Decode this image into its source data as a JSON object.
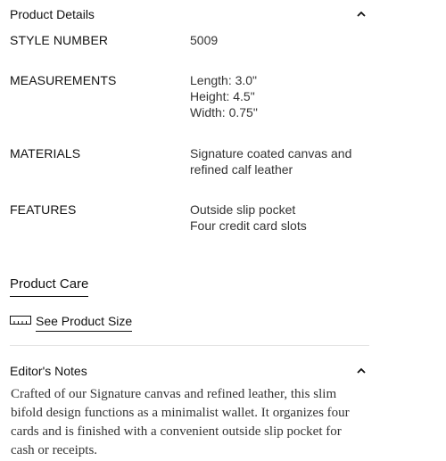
{
  "product_details": {
    "title": "Product Details",
    "toggle_icon": "chevron-up-icon",
    "rows": [
      {
        "label": "STYLE NUMBER",
        "values": [
          "5009"
        ]
      },
      {
        "label": "MEASUREMENTS",
        "values": [
          "Length: 3.0\"",
          "Height: 4.5\"",
          "Width: 0.75\""
        ]
      },
      {
        "label": "MATERIALS",
        "values": [
          "Signature coated canvas and",
          "refined calf leather"
        ]
      },
      {
        "label": "FEATURES",
        "values": [
          "Outside slip pocket",
          "Four credit card slots"
        ]
      }
    ]
  },
  "product_care": {
    "label": "Product Care"
  },
  "product_size": {
    "icon": "ruler-icon",
    "label": "See Product Size"
  },
  "editors_notes": {
    "title": "Editor's Notes",
    "toggle_icon": "chevron-up-icon",
    "lines": [
      "Crafted of our Signature canvas and refined leather, this slim",
      "bifold design functions as a minimalist wallet. It organizes four",
      "cards and is finished with a convenient outside slip pocket for",
      "cash or receipts."
    ]
  }
}
